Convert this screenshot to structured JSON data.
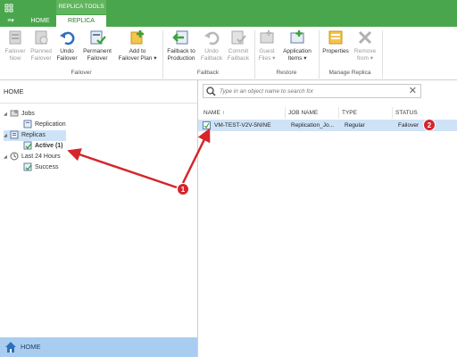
{
  "topbar": {
    "tool_group": "REPLICA TOOLS",
    "menu": "≡▾",
    "tabs": [
      {
        "label": "HOME"
      },
      {
        "label": "REPLICA"
      }
    ],
    "accent": "#4aa64c"
  },
  "ribbon": {
    "buttons": [
      {
        "label1": "Failover",
        "label2": "Now",
        "icon": "failover-now-icon",
        "enabled": false
      },
      {
        "label1": "Planned",
        "label2": "Failover",
        "icon": "planned-failover-icon",
        "enabled": false
      },
      {
        "label1": "Undo",
        "label2": "Failover",
        "icon": "undo-failover-icon",
        "enabled": true
      },
      {
        "label1": "Permanent",
        "label2": "Failover",
        "icon": "permanent-failover-icon",
        "enabled": true
      },
      {
        "label1": "Add to",
        "label2": "Failover Plan ▾",
        "icon": "add-failover-plan-icon",
        "enabled": true
      },
      {
        "label1": "Failback to",
        "label2": "Production",
        "icon": "failback-production-icon",
        "enabled": true
      },
      {
        "label1": "Undo",
        "label2": "Failback",
        "icon": "undo-failback-icon",
        "enabled": false
      },
      {
        "label1": "Commit",
        "label2": "Failback",
        "icon": "commit-failback-icon",
        "enabled": false
      },
      {
        "label1": "Guest",
        "label2": "Files ▾",
        "icon": "guest-files-icon",
        "enabled": false
      },
      {
        "label1": "Application",
        "label2": "Items ▾",
        "icon": "application-items-icon",
        "enabled": true
      },
      {
        "label1": "Properties",
        "label2": "",
        "icon": "properties-icon",
        "enabled": true
      },
      {
        "label1": "Remove",
        "label2": "from ▾",
        "icon": "remove-icon",
        "enabled": false
      }
    ],
    "groups": [
      {
        "label": "Failover"
      },
      {
        "label": "Failback"
      },
      {
        "label": "Restore"
      },
      {
        "label": "Manage Replica"
      }
    ]
  },
  "left": {
    "title": "HOME",
    "tree": [
      {
        "label": "Jobs"
      },
      {
        "label": "Replication"
      },
      {
        "label": "Replicas"
      },
      {
        "label": "Active (1)"
      },
      {
        "label": "Last 24 Hours"
      },
      {
        "label": "Success"
      }
    ],
    "home_bar": "HOME"
  },
  "search": {
    "placeholder": "Type in an object name to search for"
  },
  "grid": {
    "columns": [
      {
        "label": "NAME ↑"
      },
      {
        "label": "JOB NAME"
      },
      {
        "label": "TYPE"
      },
      {
        "label": "STATUS"
      }
    ],
    "rows": [
      {
        "name": "VM-TEST-V2V-5NINE",
        "job": "Replication_Jo...",
        "type": "Regular",
        "status": "Failover"
      }
    ]
  },
  "annotations": {
    "badge1": "1",
    "badge2": "2",
    "color": "#d4262b"
  }
}
